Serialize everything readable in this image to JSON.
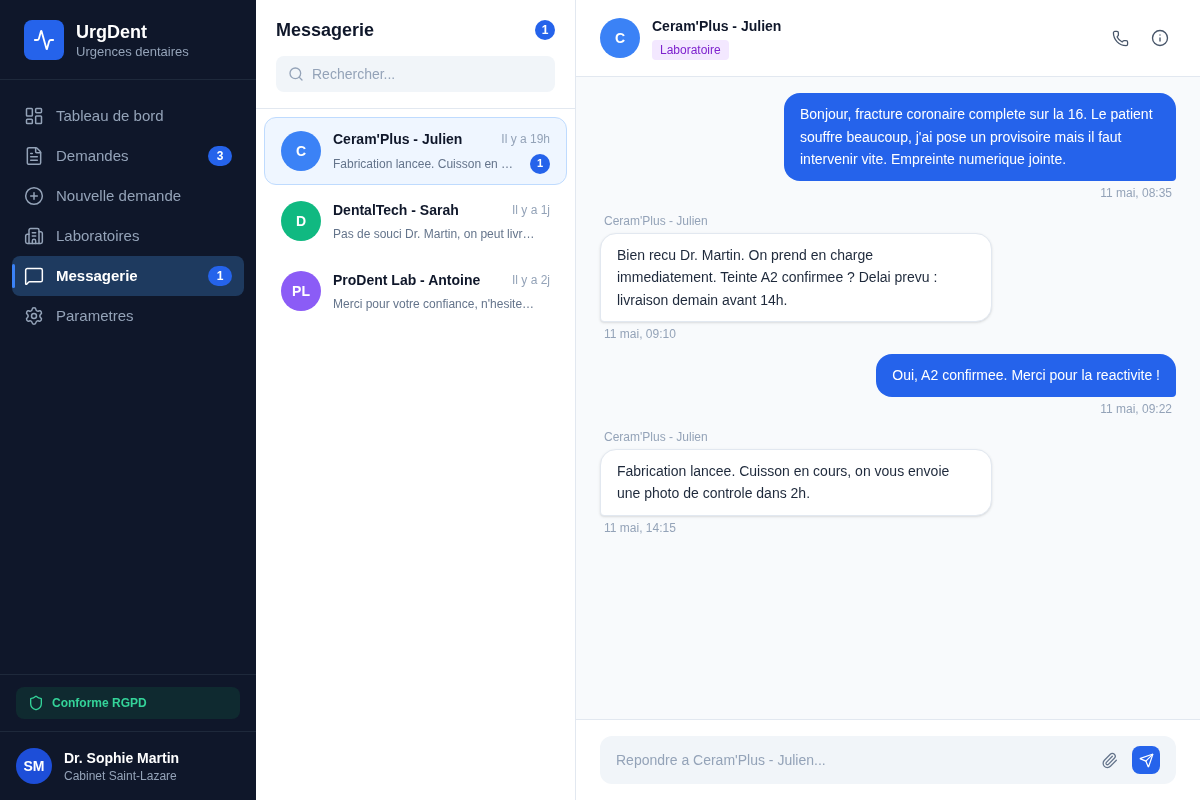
{
  "sidebar": {
    "brand": {
      "name": "UrgDent",
      "tagline": "Urgences dentaires"
    },
    "nav": [
      {
        "label": "Tableau de bord",
        "selected": false
      },
      {
        "label": "Demandes",
        "badge": "3",
        "selected": false
      },
      {
        "label": "Nouvelle demande",
        "selected": false
      },
      {
        "label": "Laboratoires",
        "selected": false
      },
      {
        "label": "Messagerie",
        "badge": "1",
        "selected": true
      },
      {
        "label": "Parametres",
        "selected": false
      }
    ],
    "compliance": "Conforme RGPD",
    "user": {
      "initials": "SM",
      "name": "Dr. Sophie Martin",
      "place": "Cabinet Saint-Lazare"
    }
  },
  "inbox": {
    "title": "Messagerie",
    "unread": "1",
    "search": {
      "placeholder": "Rechercher..."
    },
    "conversations": [
      {
        "initials": "C",
        "color": "#3b82f6",
        "name": "Ceram'Plus - Julien",
        "time": "Il y a 19h",
        "preview": "Fabrication lancee. Cuisson en …",
        "unread": "1",
        "selected": true
      },
      {
        "initials": "D",
        "color": "#10b981",
        "name": "DentalTech - Sarah",
        "time": "Il y a 1j",
        "preview": "Pas de souci Dr. Martin, on peut livr…",
        "selected": false
      },
      {
        "initials": "PL",
        "color": "#8b5cf6",
        "name": "ProDent Lab - Antoine",
        "time": "Il y a 2j",
        "preview": "Merci pour votre confiance, n'hesite…",
        "selected": false
      }
    ]
  },
  "chat": {
    "contact": {
      "initials": "C",
      "name": "Ceram'Plus - Julien",
      "tag": "Laboratoire"
    },
    "messages": [
      {
        "kind": "sent",
        "text": "Bonjour, fracture coronaire complete sur la 16. Le patient souffre beaucoup, j'ai pose un provisoire mais il faut intervenir vite. Empreinte numerique jointe.",
        "time": "11 mai, 08:35"
      },
      {
        "kind": "received",
        "sender": "Ceram'Plus - Julien",
        "text": "Bien recu Dr. Martin. On prend en charge immediatement. Teinte A2 confirmee ? Delai prevu : livraison demain avant 14h.",
        "time": "11 mai, 09:10"
      },
      {
        "kind": "sent",
        "text": "Oui, A2 confirmee. Merci pour la reactivite !",
        "time": "11 mai, 09:22"
      },
      {
        "kind": "received",
        "sender": "Ceram'Plus - Julien",
        "text": "Fabrication lancee. Cuisson en cours, on vous envoie une photo de controle dans 2h.",
        "time": "11 mai, 14:15"
      }
    ],
    "composer": {
      "placeholder": "Repondre a Ceram'Plus - Julien..."
    }
  }
}
